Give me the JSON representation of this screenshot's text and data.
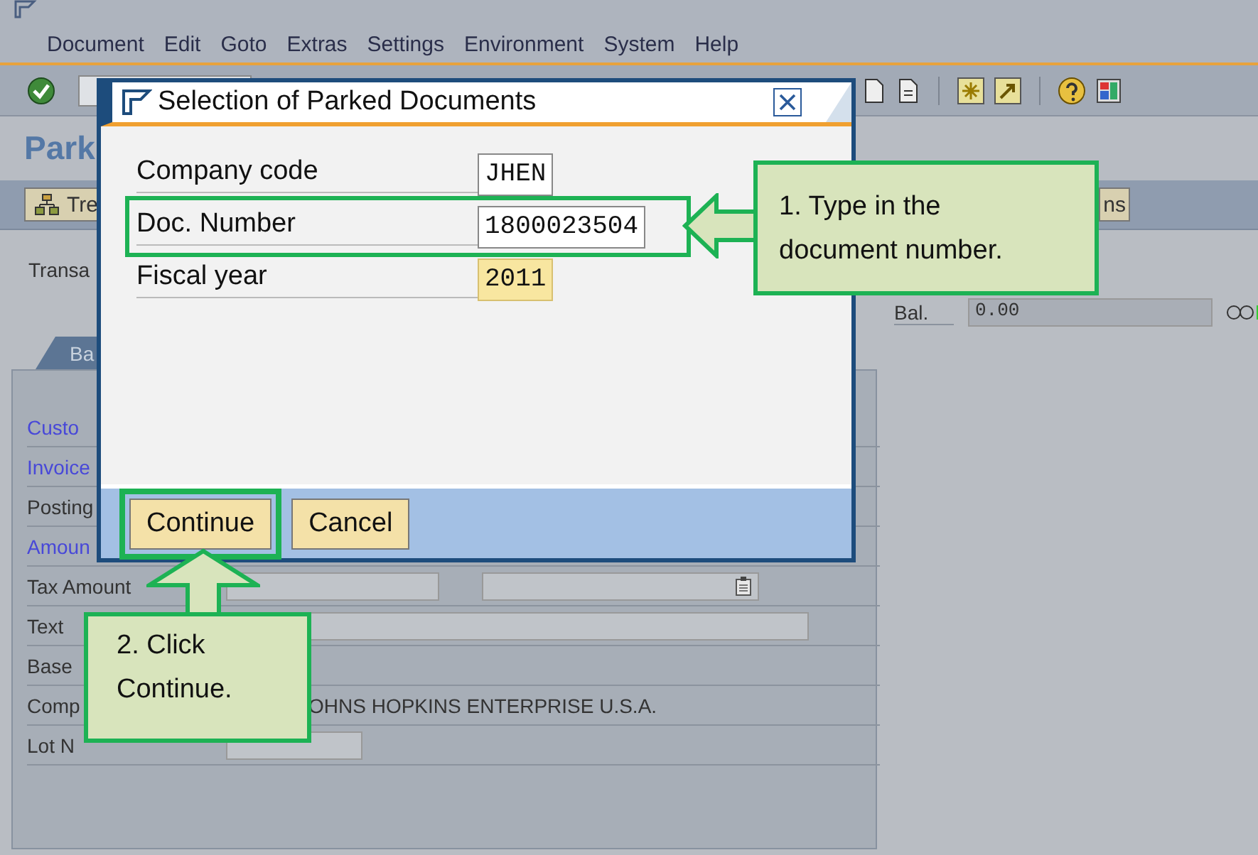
{
  "screen": {
    "menu": [
      {
        "label": "Document"
      },
      {
        "label": "Edit"
      },
      {
        "label": "Goto"
      },
      {
        "label": "Extras"
      },
      {
        "label": "Settings"
      },
      {
        "label": "Environment"
      },
      {
        "label": "System"
      },
      {
        "label": "Help"
      }
    ],
    "title": "Park",
    "toolbar_buttons": [
      {
        "label": "Tre"
      },
      {
        "label": "ns"
      }
    ],
    "transaction_label": "Transa",
    "balance": {
      "label": "Bal.",
      "value": "0.00"
    },
    "tab": {
      "label": "Ba",
      "selected": true
    },
    "form_rows": [
      {
        "label": "Custo",
        "kind": "link"
      },
      {
        "label": "Invoice",
        "kind": "link"
      },
      {
        "label": "Posting",
        "kind": "text"
      },
      {
        "label": "Amoun",
        "kind": "link"
      },
      {
        "label": "Tax Amount",
        "kind": "amount"
      },
      {
        "label": "Text",
        "kind": "line"
      },
      {
        "label": "Base",
        "kind": "text"
      },
      {
        "label": "Comp",
        "kind": "company",
        "value": "OHNS HOPKINS ENTERPRISE U.S.A."
      },
      {
        "label": "Lot N",
        "kind": "lot"
      }
    ]
  },
  "dialog": {
    "title": "Selection of Parked Documents",
    "fields": [
      {
        "label": "Company code",
        "value": "JHEN",
        "highlighted": false,
        "annotated": false
      },
      {
        "label": "Doc. Number",
        "value": "1800023504",
        "highlighted": false,
        "annotated": true
      },
      {
        "label": "Fiscal year",
        "value": "2011",
        "highlighted": true,
        "annotated": false
      }
    ],
    "buttons": [
      {
        "label": "Continue",
        "annotated": true
      },
      {
        "label": "Cancel",
        "annotated": false
      }
    ]
  },
  "callouts": [
    {
      "text": "1. Type in the document number.",
      "kind": "left"
    },
    {
      "text": "2. Click Continue.",
      "kind": "up"
    }
  ]
}
